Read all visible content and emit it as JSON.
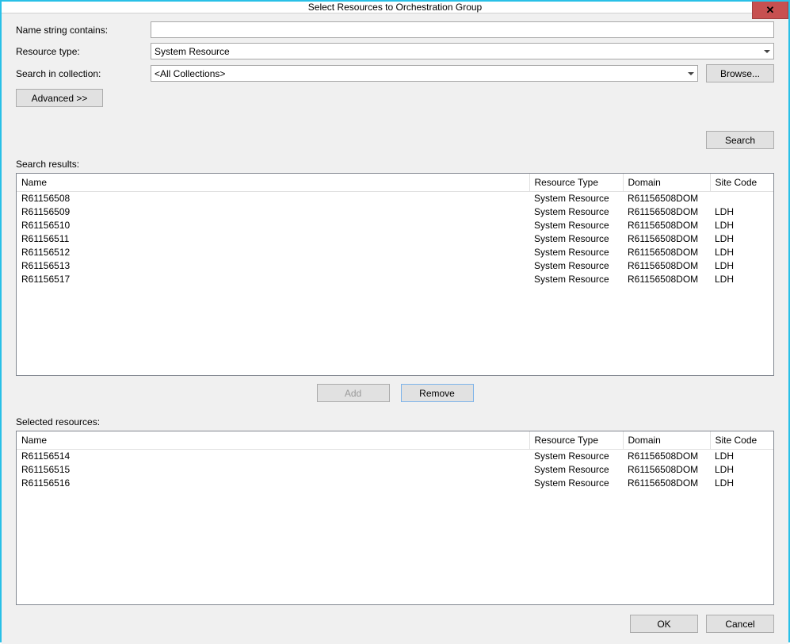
{
  "window": {
    "title": "Select Resources to Orchestration Group",
    "close_glyph": "✕"
  },
  "labels": {
    "name_contains": "Name string contains:",
    "resource_type": "Resource type:",
    "search_in": "Search in collection:",
    "advanced": "Advanced >>",
    "browse": "Browse...",
    "search": "Search",
    "search_results": "Search results:",
    "selected_resources": "Selected resources:",
    "add": "Add",
    "remove": "Remove",
    "ok": "OK",
    "cancel": "Cancel"
  },
  "inputs": {
    "name_value": "",
    "resource_type_value": "System Resource",
    "collection_value": "<All Collections>"
  },
  "columns": {
    "name": "Name",
    "restype": "Resource Type",
    "domain": "Domain",
    "site": "Site Code"
  },
  "search_results": [
    {
      "name": "R61156508",
      "restype": "System Resource",
      "domain": "R61156508DOM",
      "site": ""
    },
    {
      "name": "R61156509",
      "restype": "System Resource",
      "domain": "R61156508DOM",
      "site": "LDH"
    },
    {
      "name": "R61156510",
      "restype": "System Resource",
      "domain": "R61156508DOM",
      "site": "LDH"
    },
    {
      "name": "R61156511",
      "restype": "System Resource",
      "domain": "R61156508DOM",
      "site": "LDH"
    },
    {
      "name": "R61156512",
      "restype": "System Resource",
      "domain": "R61156508DOM",
      "site": "LDH"
    },
    {
      "name": "R61156513",
      "restype": "System Resource",
      "domain": "R61156508DOM",
      "site": "LDH"
    },
    {
      "name": "R61156517",
      "restype": "System Resource",
      "domain": "R61156508DOM",
      "site": "LDH"
    }
  ],
  "selected_resources": [
    {
      "name": "R61156514",
      "restype": "System Resource",
      "domain": "R61156508DOM",
      "site": "LDH"
    },
    {
      "name": "R61156515",
      "restype": "System Resource",
      "domain": "R61156508DOM",
      "site": "LDH"
    },
    {
      "name": "R61156516",
      "restype": "System Resource",
      "domain": "R61156508DOM",
      "site": "LDH"
    }
  ]
}
